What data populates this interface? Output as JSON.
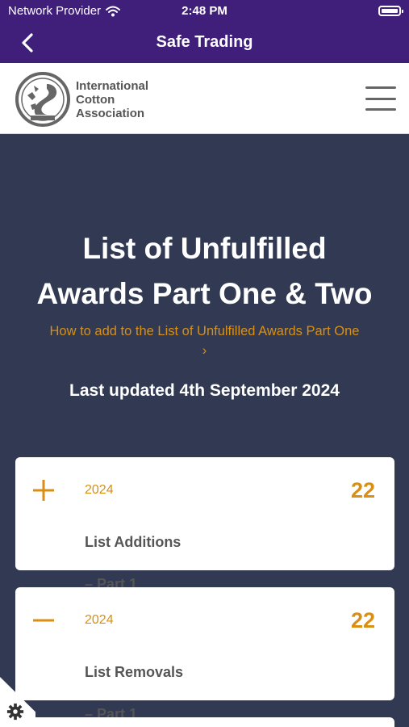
{
  "status_bar": {
    "carrier": "Network Provider",
    "time": "2:48 PM"
  },
  "nav": {
    "title": "Safe Trading"
  },
  "header": {
    "logo_lines": [
      "International",
      "Cotton",
      "Association"
    ]
  },
  "hero": {
    "title_line1": "List of Unfulfilled",
    "title_line2": "Awards Part One & Two",
    "link_text": "How to add to the List of Unfulfilled Awards Part One",
    "link_chevron": "›",
    "updated": "Last updated 4th September 2024"
  },
  "cards": [
    {
      "sign": "+",
      "year": "2024",
      "count": "22",
      "label_line1": "List Additions",
      "label_line2": "– Part 1"
    },
    {
      "sign": "−",
      "year": "2024",
      "count": "22",
      "label_line1": "List Removals",
      "label_line2": "– Part 1"
    }
  ],
  "colors": {
    "nav_bg": "#3f1f7a",
    "page_bg": "#323a53",
    "accent": "#d88f13"
  }
}
